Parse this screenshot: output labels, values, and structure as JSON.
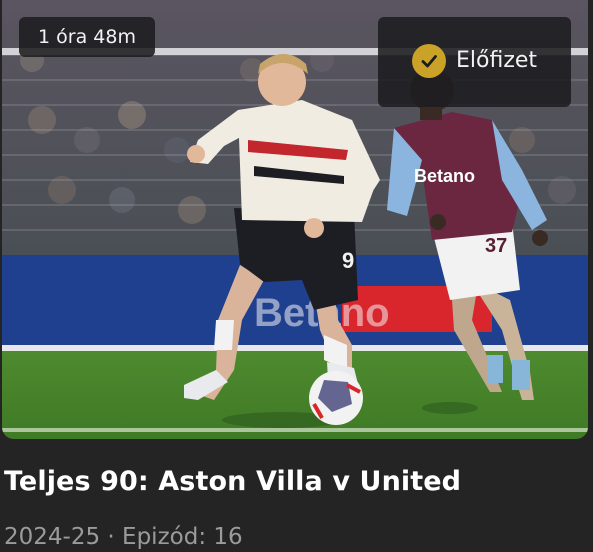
{
  "card": {
    "duration": "1 óra 48m",
    "subscribe_label": "Előfizet",
    "title": "Teljes 90: Aston Villa v United",
    "season": "2024-25",
    "separator": "·",
    "episode": "Epizód: 16",
    "thumbnail_board_text": "Betano",
    "player_left_number": "9",
    "player_right_number": "37",
    "player_right_sponsor": "Betano"
  },
  "colors": {
    "background": "#242424",
    "badge_bg": "#1c1c20",
    "accent_gold": "#c9a227",
    "meta_text": "#9b9b9b"
  },
  "icons": {
    "subscribe": "checkmark-badge-icon"
  }
}
